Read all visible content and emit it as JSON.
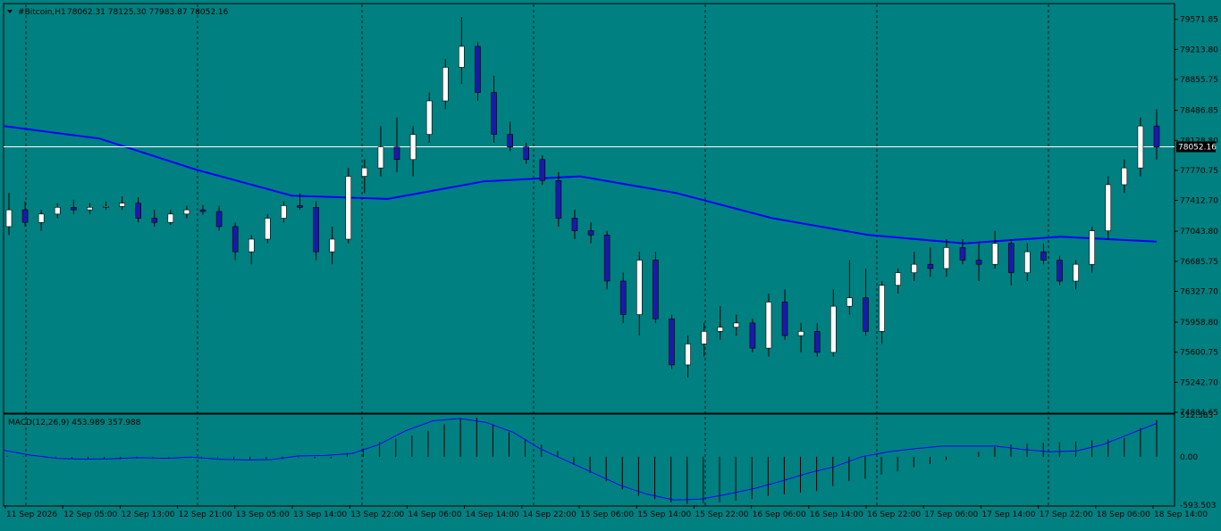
{
  "chart_data": [
    {
      "type": "candlestick",
      "symbol": "#Bitcoin,H1",
      "ohlc_header": "78062.31 78125.30 77983.87 78052.16",
      "current_price": "78052.16",
      "y_tick_labels": [
        "79571.85",
        "79213.80",
        "78855.75",
        "78486.85",
        "78128.80",
        "77770.75",
        "77412.70",
        "77043.80",
        "76685.75",
        "76327.70",
        "75958.80",
        "75600.75",
        "75242.70",
        "74884.65"
      ],
      "ylim": [
        74884.65,
        79750
      ],
      "ma_level": [
        78300,
        78150,
        77780,
        77470,
        77430,
        77640,
        77700,
        77500,
        77200,
        77000,
        76900,
        76980,
        76920
      ],
      "candles": [
        [
          77100,
          77500,
          77000,
          77300
        ],
        [
          77300,
          77400,
          77100,
          77150
        ],
        [
          77150,
          77300,
          77050,
          77250
        ],
        [
          77250,
          77380,
          77200,
          77330
        ],
        [
          77330,
          77420,
          77250,
          77300
        ],
        [
          77300,
          77380,
          77250,
          77330
        ],
        [
          77330,
          77400,
          77300,
          77340
        ],
        [
          77340,
          77460,
          77300,
          77380
        ],
        [
          77380,
          77450,
          77150,
          77200
        ],
        [
          77200,
          77300,
          77100,
          77150
        ],
        [
          77150,
          77300,
          77120,
          77250
        ],
        [
          77250,
          77350,
          77200,
          77300
        ],
        [
          77300,
          77360,
          77240,
          77280
        ],
        [
          77280,
          77350,
          77050,
          77100
        ],
        [
          77100,
          77150,
          76700,
          76800
        ],
        [
          76800,
          77000,
          76650,
          76950
        ],
        [
          76950,
          77250,
          76900,
          77200
        ],
        [
          77200,
          77400,
          77150,
          77350
        ],
        [
          77350,
          77500,
          77300,
          77330
        ],
        [
          77330,
          77400,
          76700,
          76800
        ],
        [
          76800,
          77100,
          76650,
          76950
        ],
        [
          76950,
          77800,
          76900,
          77700
        ],
        [
          77700,
          77900,
          77500,
          77800
        ],
        [
          77800,
          78300,
          77700,
          78050
        ],
        [
          78050,
          78400,
          77750,
          77900
        ],
        [
          77900,
          78300,
          77700,
          78200
        ],
        [
          78200,
          78700,
          78100,
          78600
        ],
        [
          78600,
          79100,
          78500,
          79000
        ],
        [
          79000,
          79600,
          78800,
          79250
        ],
        [
          79250,
          79300,
          78600,
          78700
        ],
        [
          78700,
          78900,
          78100,
          78200
        ],
        [
          78200,
          78350,
          78000,
          78050
        ],
        [
          78050,
          78100,
          77850,
          77900
        ],
        [
          77900,
          77950,
          77600,
          77650
        ],
        [
          77650,
          77750,
          77100,
          77200
        ],
        [
          77200,
          77300,
          76950,
          77050
        ],
        [
          77050,
          77150,
          76900,
          77000
        ],
        [
          77000,
          77050,
          76350,
          76450
        ],
        [
          76450,
          76550,
          75950,
          76050
        ],
        [
          76050,
          76800,
          75800,
          76700
        ],
        [
          76700,
          76800,
          75950,
          76000
        ],
        [
          76000,
          76050,
          75400,
          75450
        ],
        [
          75450,
          75800,
          75300,
          75700
        ],
        [
          75700,
          75950,
          75550,
          75850
        ],
        [
          75850,
          76150,
          75750,
          75900
        ],
        [
          75900,
          76050,
          75800,
          75950
        ],
        [
          75950,
          76000,
          75600,
          75650
        ],
        [
          75650,
          76300,
          75550,
          76200
        ],
        [
          76200,
          76350,
          75750,
          75800
        ],
        [
          75800,
          75950,
          75600,
          75850
        ],
        [
          75850,
          75950,
          75550,
          75600
        ],
        [
          75600,
          76350,
          75550,
          76150
        ],
        [
          76150,
          76700,
          76050,
          76250
        ],
        [
          76250,
          76600,
          75800,
          75850
        ],
        [
          75850,
          76450,
          75700,
          76400
        ],
        [
          76400,
          76600,
          76300,
          76550
        ],
        [
          76550,
          76800,
          76450,
          76650
        ],
        [
          76650,
          76850,
          76500,
          76600
        ],
        [
          76600,
          76950,
          76500,
          76850
        ],
        [
          76850,
          76950,
          76650,
          76700
        ],
        [
          76700,
          76900,
          76450,
          76650
        ],
        [
          76650,
          77050,
          76600,
          76900
        ],
        [
          76900,
          76950,
          76400,
          76550
        ],
        [
          76550,
          76900,
          76450,
          76800
        ],
        [
          76800,
          76900,
          76650,
          76700
        ],
        [
          76700,
          76750,
          76400,
          76450
        ],
        [
          76450,
          76700,
          76350,
          76650
        ],
        [
          76650,
          77100,
          76550,
          77050
        ],
        [
          77050,
          77700,
          76950,
          77600
        ],
        [
          77600,
          77900,
          77500,
          77800
        ],
        [
          77800,
          78400,
          77700,
          78300
        ],
        [
          78300,
          78500,
          77900,
          78050
        ]
      ]
    },
    {
      "type": "macd",
      "label": "MACD(12,26,9) 453.989 357.988",
      "y_tick_labels": [
        "512.383",
        "0.00",
        "-593.503"
      ],
      "ylim": [
        -593.503,
        512.383
      ],
      "histogram": [
        10,
        5,
        0,
        -10,
        -20,
        -30,
        -30,
        -30,
        -20,
        -10,
        -10,
        -10,
        -10,
        -10,
        -30,
        -40,
        -40,
        -30,
        -10,
        -20,
        -20,
        50,
        100,
        180,
        220,
        260,
        320,
        400,
        460,
        480,
        400,
        300,
        220,
        150,
        70,
        -100,
        -200,
        -300,
        -400,
        -480,
        -520,
        -560,
        -580,
        -570,
        -560,
        -540,
        -520,
        -480,
        -460,
        -440,
        -420,
        -360,
        -300,
        -270,
        -220,
        -180,
        -130,
        -90,
        -40,
        0,
        60,
        120,
        150,
        160,
        170,
        180,
        190,
        200,
        210,
        230,
        350,
        450
      ],
      "signal": [
        80,
        20,
        -20,
        -30,
        -25,
        -10,
        -20,
        -5,
        -30,
        -40,
        -35,
        10,
        15,
        40,
        150,
        320,
        440,
        470,
        420,
        300,
        100,
        -50,
        -200,
        -350,
        -460,
        -530,
        -520,
        -460,
        -390,
        -300,
        -200,
        -120,
        0,
        60,
        100,
        130,
        130,
        130,
        90,
        60,
        70,
        150,
        280,
        410
      ]
    }
  ],
  "x_tick_labels": [
    "11 Sep 2026",
    "12 Sep 05:00",
    "12 Sep 13:00",
    "12 Sep 21:00",
    "13 Sep 05:00",
    "13 Sep 14:00",
    "13 Sep 22:00",
    "14 Sep 06:00",
    "14 Sep 14:00",
    "14 Sep 22:00",
    "15 Sep 06:00",
    "15 Sep 14:00",
    "15 Sep 22:00",
    "16 Sep 06:00",
    "16 Sep 14:00",
    "16 Sep 22:00",
    "17 Sep 06:00",
    "17 Sep 14:00",
    "17 Sep 22:00",
    "18 Sep 06:00",
    "18 Sep 14:00"
  ],
  "colors": {
    "background": "#008080",
    "bull_fill": "#ffffff",
    "bear_fill": "#1a1aa8",
    "wick": "#000000",
    "ma_line": "#0000ff",
    "price_line": "#ffffff",
    "text": "#000000",
    "grid": "#000000"
  }
}
